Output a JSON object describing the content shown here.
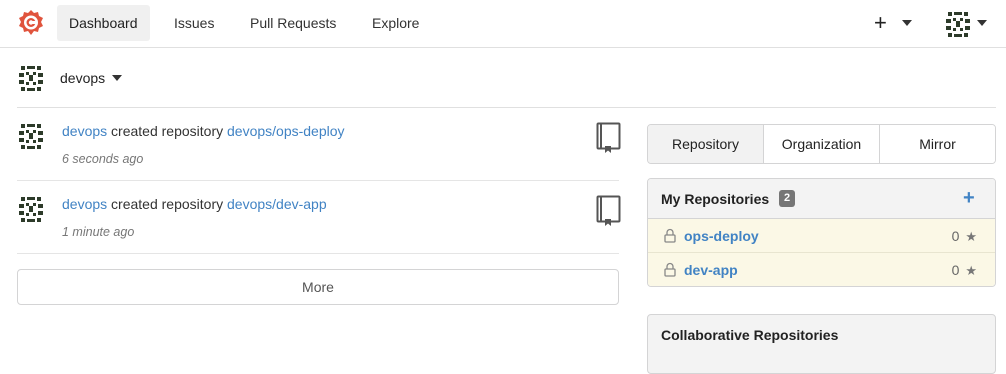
{
  "nav": {
    "items": [
      "Dashboard",
      "Issues",
      "Pull Requests",
      "Explore"
    ],
    "active": "Dashboard",
    "plus_label": "+"
  },
  "context": {
    "name": "devops"
  },
  "feed": [
    {
      "user": "devops",
      "action": "created repository",
      "repo": "devops/ops-deploy",
      "time": "6 seconds ago"
    },
    {
      "user": "devops",
      "action": "created repository",
      "repo": "devops/dev-app",
      "time": "1 minute ago"
    }
  ],
  "feed_more": "More",
  "tabs": [
    "Repository",
    "Organization",
    "Mirror"
  ],
  "repos_panel": {
    "title": "My Repositories",
    "count": "2",
    "add": "+",
    "items": [
      {
        "name": "ops-deploy",
        "stars": "0"
      },
      {
        "name": "dev-app",
        "stars": "0"
      }
    ]
  },
  "collab_panel": {
    "title": "Collaborative Repositories"
  },
  "colors": {
    "link": "#4183c4",
    "logo": "#e0543d",
    "repo_row_bg": "#fbf8e6"
  },
  "icons": [
    "gitea-logo-icon",
    "identicon-avatar-icon",
    "book-icon",
    "lock-icon",
    "star-icon",
    "chevron-down-icon"
  ]
}
